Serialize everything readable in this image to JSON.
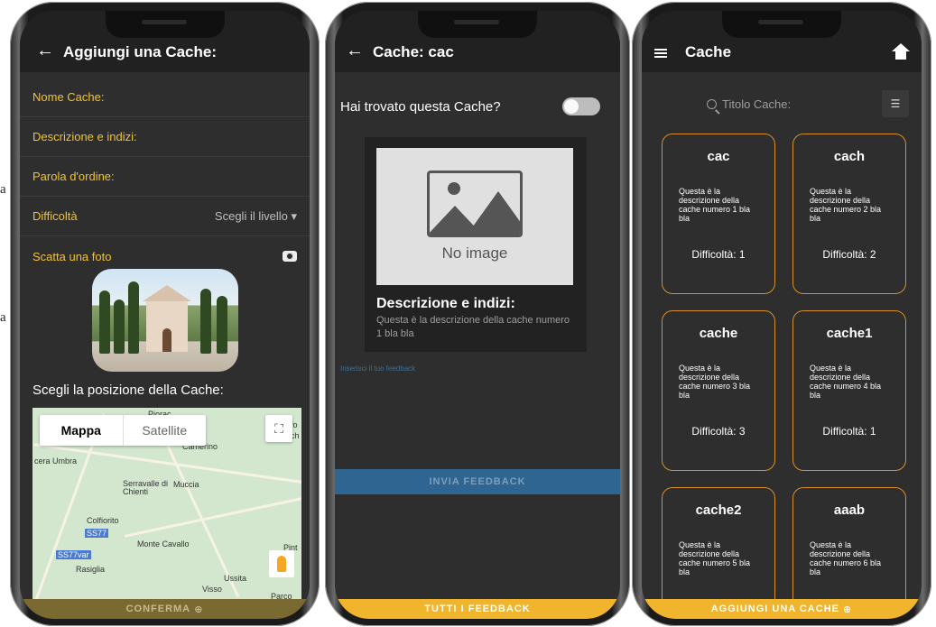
{
  "edge_marks": [
    "a",
    "a"
  ],
  "phone1": {
    "title": "Aggiungi una Cache:",
    "fields": {
      "name": "Nome Cache:",
      "description": "Descrizione e indizi:",
      "password": "Parola d'ordine:",
      "difficulty": "Difficoltà",
      "difficulty_select": "Scegli il livello",
      "photo": "Scatta una foto"
    },
    "position_title": "Scegli la posizione della Cache:",
    "map": {
      "tab_map": "Mappa",
      "tab_satellite": "Satellite",
      "places": [
        "Piorac",
        "Camerino",
        "cera Umbra",
        "Serravalle di Chienti",
        "Muccia",
        "Colfiorito",
        "SS77",
        "Monte Cavallo",
        "SS77var",
        "Rasiglia",
        "Ussita",
        "Visso",
        "Parco",
        "Pint",
        "fo",
        "ch"
      ]
    },
    "confirm": "CONFERMA"
  },
  "phone2": {
    "title": "Cache: cac",
    "found_question": "Hai trovato questa Cache?",
    "no_image": "No image",
    "desc_title": "Descrizione e indizi:",
    "desc_text": "Questa è la descrizione della cache numero 1 bla bla",
    "feedback_hint": "Inserisci il tuo feedback",
    "send_feedback": "INVIA FEEDBACK",
    "all_feedback": "TUTTI I FEEDBACK"
  },
  "phone3": {
    "title": "Cache",
    "search_placeholder": "Titolo Cache:",
    "caches": [
      {
        "name": "cac",
        "desc": "Questa è la descrizione della cache numero 1 bla bla",
        "difficulty": "Difficoltà: 1"
      },
      {
        "name": "cach",
        "desc": "Questa è la descrizione della cache numero 2 bla bla",
        "difficulty": "Difficoltà: 2"
      },
      {
        "name": "cache",
        "desc": "Questa è la descrizione della cache numero 3 bla bla",
        "difficulty": "Difficoltà: 3"
      },
      {
        "name": "cache1",
        "desc": "Questa è la descrizione della cache numero 4 bla bla",
        "difficulty": "Difficoltà: 1"
      },
      {
        "name": "cache2",
        "desc": "Questa è la descrizione della cache numero 5 bla bla",
        "difficulty": ""
      },
      {
        "name": "aaab",
        "desc": "Questa è la descrizione della cache numero 6 bla bla",
        "difficulty": ""
      }
    ],
    "add_cache": "AGGIUNGI UNA CACHE"
  },
  "colors": {
    "accent": "#f0b42d",
    "label_yellow": "#f2c230",
    "card_border": "#d7902a",
    "button_blue": "#2f6591",
    "screen_bg": "#2e2e2e"
  }
}
